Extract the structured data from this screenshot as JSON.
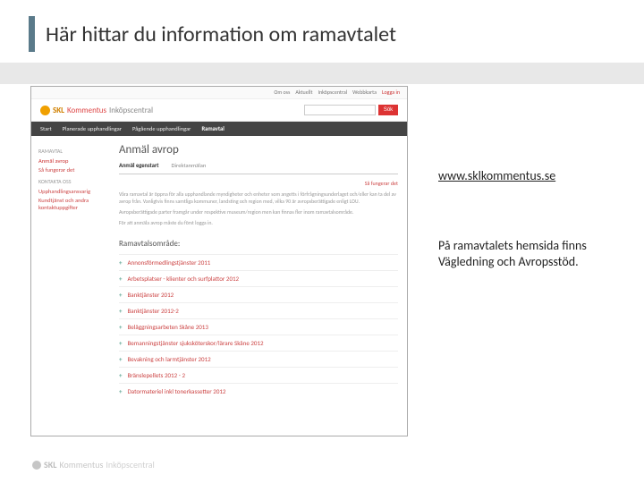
{
  "slide": {
    "title": "Här hittar du information om ramavtalet",
    "link": "www.sklkommentus.se",
    "body": "På ramavtalets hemsida finns Vägledning och Avropsstöd."
  },
  "screenshot": {
    "topbar": {
      "a": "Om oss",
      "b": "Aktuellt",
      "c": "Inköpscentral",
      "d": "Webbkarta",
      "e": "Logga in"
    },
    "logo": {
      "brand1": "SKL",
      "brand2": "Kommentus",
      "brand3": "Inköpscentral"
    },
    "search": {
      "placeholder": "",
      "button": "Sök"
    },
    "nav": {
      "a": "Start",
      "b": "Planerade upphandlingar",
      "c": "Pågående upphandlingar",
      "d": "Ramavtal"
    },
    "sidebar": {
      "h1": "RAMAVTAL",
      "l1": "Anmäl avrop",
      "l2": "Så fungerar det",
      "h2": "KONTAKTA OSS",
      "l3": "Upphandlingsansvarig",
      "l4": "Kundtjänst och andra kontaktuppgifter"
    },
    "main": {
      "heading": "Anmäl avrop",
      "tab_active": "Anmäl egenstart",
      "tab_other": "Direktanmälan",
      "sub_left": "",
      "sub_right": "Så fungerar det",
      "para1": "Våra ramavtal är öppna för alla upphandlande myndigheter och enheter som angetts i förfrågningsunderlaget och/eller kan ta del av avrop från. Vanligtvis finns samtliga kommuner, landsting och region med, vilka 90 är avropsberättigade enligt LOU.",
      "para2": "Avropsberättigade parter framgår under respektive museum/region men kan finnas fler inom ramavtalsområde.",
      "para3": "För att anmäla avrop måste du först logga in.",
      "group_heading": "Ramavtalsområde:",
      "items": [
        "Annonsförmedlingstjänster 2011",
        "Arbetsplatser - klienter och surfplattor 2012",
        "Banktjänster 2012",
        "Banktjänster 2012-2",
        "Beläggningsarbeten Skåne 2013",
        "Bemanningstjänster sjuksköterskor/lärare Skåne 2012",
        "Bevakning och larmtjänster 2012",
        "Bränslepellets 2012 - 2",
        "Datormateriel inkl tonerkassetter 2012"
      ]
    }
  },
  "footer": {
    "brand1": "SKL",
    "brand2": "Kommentus",
    "brand3": "Inköpscentral"
  }
}
